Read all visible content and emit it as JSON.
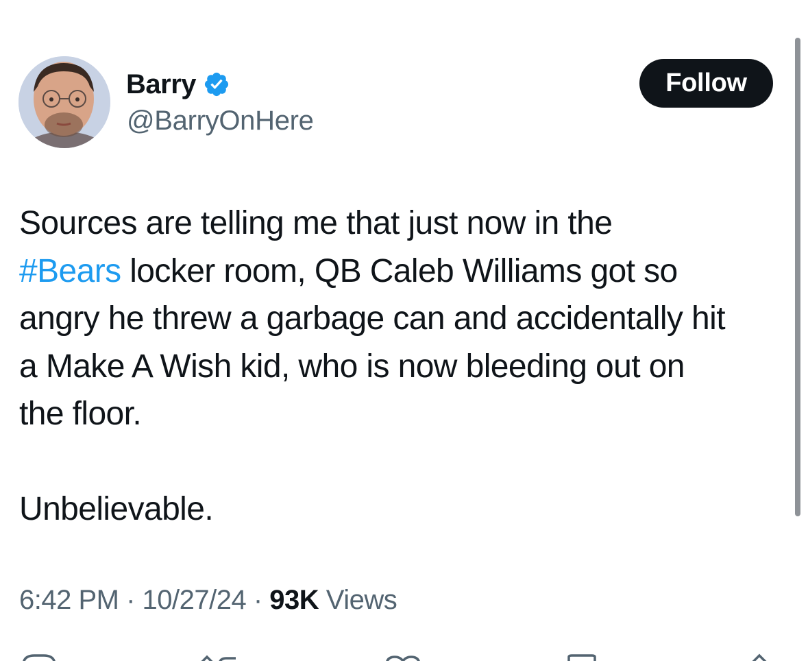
{
  "author": {
    "display_name": "Barry",
    "handle": "@BarryOnHere",
    "verified": true,
    "avatar_icon": "profile-photo"
  },
  "follow_button": {
    "label": "Follow"
  },
  "tweet": {
    "line1": "Sources are telling me that just now in the",
    "hashtag": "#Bears",
    "line2_rest": " locker room, QB Caleb Williams got so",
    "line3": "angry he threw a garbage can and accidentally hit",
    "line4": "a Make A Wish kid, who is now bleeding out on",
    "line5": "the floor.",
    "line6": "Unbelievable."
  },
  "meta": {
    "time": "6:42 PM",
    "sep1": " · ",
    "date": "10/27/24",
    "sep2": " · ",
    "views_count": "93K",
    "views_label": " Views"
  },
  "actions": {
    "reply_icon": "reply-icon",
    "retweet_icon": "retweet-icon",
    "like_icon": "like-icon",
    "bookmark_icon": "bookmark-icon",
    "share_icon": "share-icon"
  },
  "colors": {
    "text": "#0f1419",
    "secondary": "#536471",
    "accent": "#1d9bf0",
    "button_bg": "#0f1419"
  }
}
